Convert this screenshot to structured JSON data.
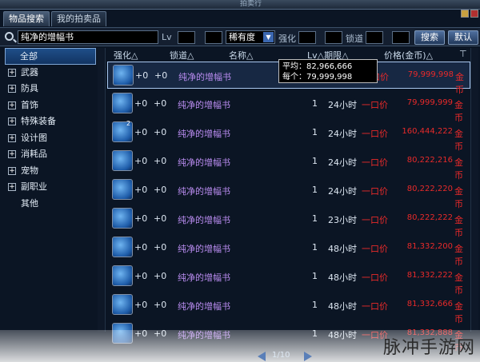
{
  "window": {
    "title": "拍卖行"
  },
  "tabs": [
    {
      "label": "物品搜索",
      "active": true
    },
    {
      "label": "我的拍卖品",
      "active": false
    }
  ],
  "search": {
    "value": "纯净的增幅书",
    "lv_label": "Lv",
    "rarity_value": "稀有度",
    "enhance_label": "强化",
    "lock_label": "锁道",
    "search_button": "搜索",
    "default_button": "默认"
  },
  "sidebar": {
    "items": [
      {
        "label": "全部",
        "expandable": false,
        "selected": true
      },
      {
        "label": "武器",
        "expandable": true
      },
      {
        "label": "防具",
        "expandable": true
      },
      {
        "label": "首饰",
        "expandable": true
      },
      {
        "label": "特殊装备",
        "expandable": true
      },
      {
        "label": "设计图",
        "expandable": true
      },
      {
        "label": "消耗品",
        "expandable": true
      },
      {
        "label": "宠物",
        "expandable": true
      },
      {
        "label": "副职业",
        "expandable": true
      },
      {
        "label": "其他",
        "expandable": false
      }
    ]
  },
  "table": {
    "headers": {
      "enhance": "强化△",
      "lock": "锁道△",
      "name": "名称△",
      "lv_time": "Lv△期限△",
      "price": "价格(金币)△"
    },
    "rows": [
      {
        "enhance": "+0",
        "lock": "+0",
        "name": "纯净的增幅书",
        "lv": "",
        "time": "",
        "type": "一口价",
        "price": "79,999,998",
        "currency": "金币",
        "stack": "",
        "selected": true
      },
      {
        "enhance": "+0",
        "lock": "+0",
        "name": "纯净的增幅书",
        "lv": "1",
        "time": "24小时",
        "type": "一口价",
        "price": "79,999,999",
        "currency": "金币",
        "stack": ""
      },
      {
        "enhance": "+0",
        "lock": "+0",
        "name": "纯净的增幅书",
        "lv": "1",
        "time": "24小时",
        "type": "一口价",
        "price": "160,444,222",
        "currency": "金币",
        "stack": "2"
      },
      {
        "enhance": "+0",
        "lock": "+0",
        "name": "纯净的增幅书",
        "lv": "1",
        "time": "24小时",
        "type": "一口价",
        "price": "80,222,216",
        "currency": "金币",
        "stack": ""
      },
      {
        "enhance": "+0",
        "lock": "+0",
        "name": "纯净的增幅书",
        "lv": "1",
        "time": "24小时",
        "type": "一口价",
        "price": "80,222,220",
        "currency": "金币",
        "stack": ""
      },
      {
        "enhance": "+0",
        "lock": "+0",
        "name": "纯净的增幅书",
        "lv": "1",
        "time": "23小时",
        "type": "一口价",
        "price": "80,222,222",
        "currency": "金币",
        "stack": ""
      },
      {
        "enhance": "+0",
        "lock": "+0",
        "name": "纯净的增幅书",
        "lv": "1",
        "time": "48小时",
        "type": "一口价",
        "price": "81,332,200",
        "currency": "金币",
        "stack": ""
      },
      {
        "enhance": "+0",
        "lock": "+0",
        "name": "纯净的增幅书",
        "lv": "1",
        "time": "48小时",
        "type": "一口价",
        "price": "81,332,222",
        "currency": "金币",
        "stack": ""
      },
      {
        "enhance": "+0",
        "lock": "+0",
        "name": "纯净的增幅书",
        "lv": "1",
        "time": "48小时",
        "type": "一口价",
        "price": "81,332,666",
        "currency": "金币",
        "stack": ""
      },
      {
        "enhance": "+0",
        "lock": "+0",
        "name": "纯净的增幅书",
        "lv": "1",
        "time": "48小时",
        "type": "一口价",
        "price": "81,332,888",
        "currency": "金币",
        "stack": ""
      }
    ]
  },
  "tooltip": {
    "avg": "平均：82,966,666",
    "each": "每个：79,999,998"
  },
  "pager": {
    "text": "1/10"
  },
  "watermark": "脉冲手游网",
  "colors": {
    "price": "#e82a2a",
    "item_name": "#b98cf0",
    "accent": "#3b67b0"
  }
}
